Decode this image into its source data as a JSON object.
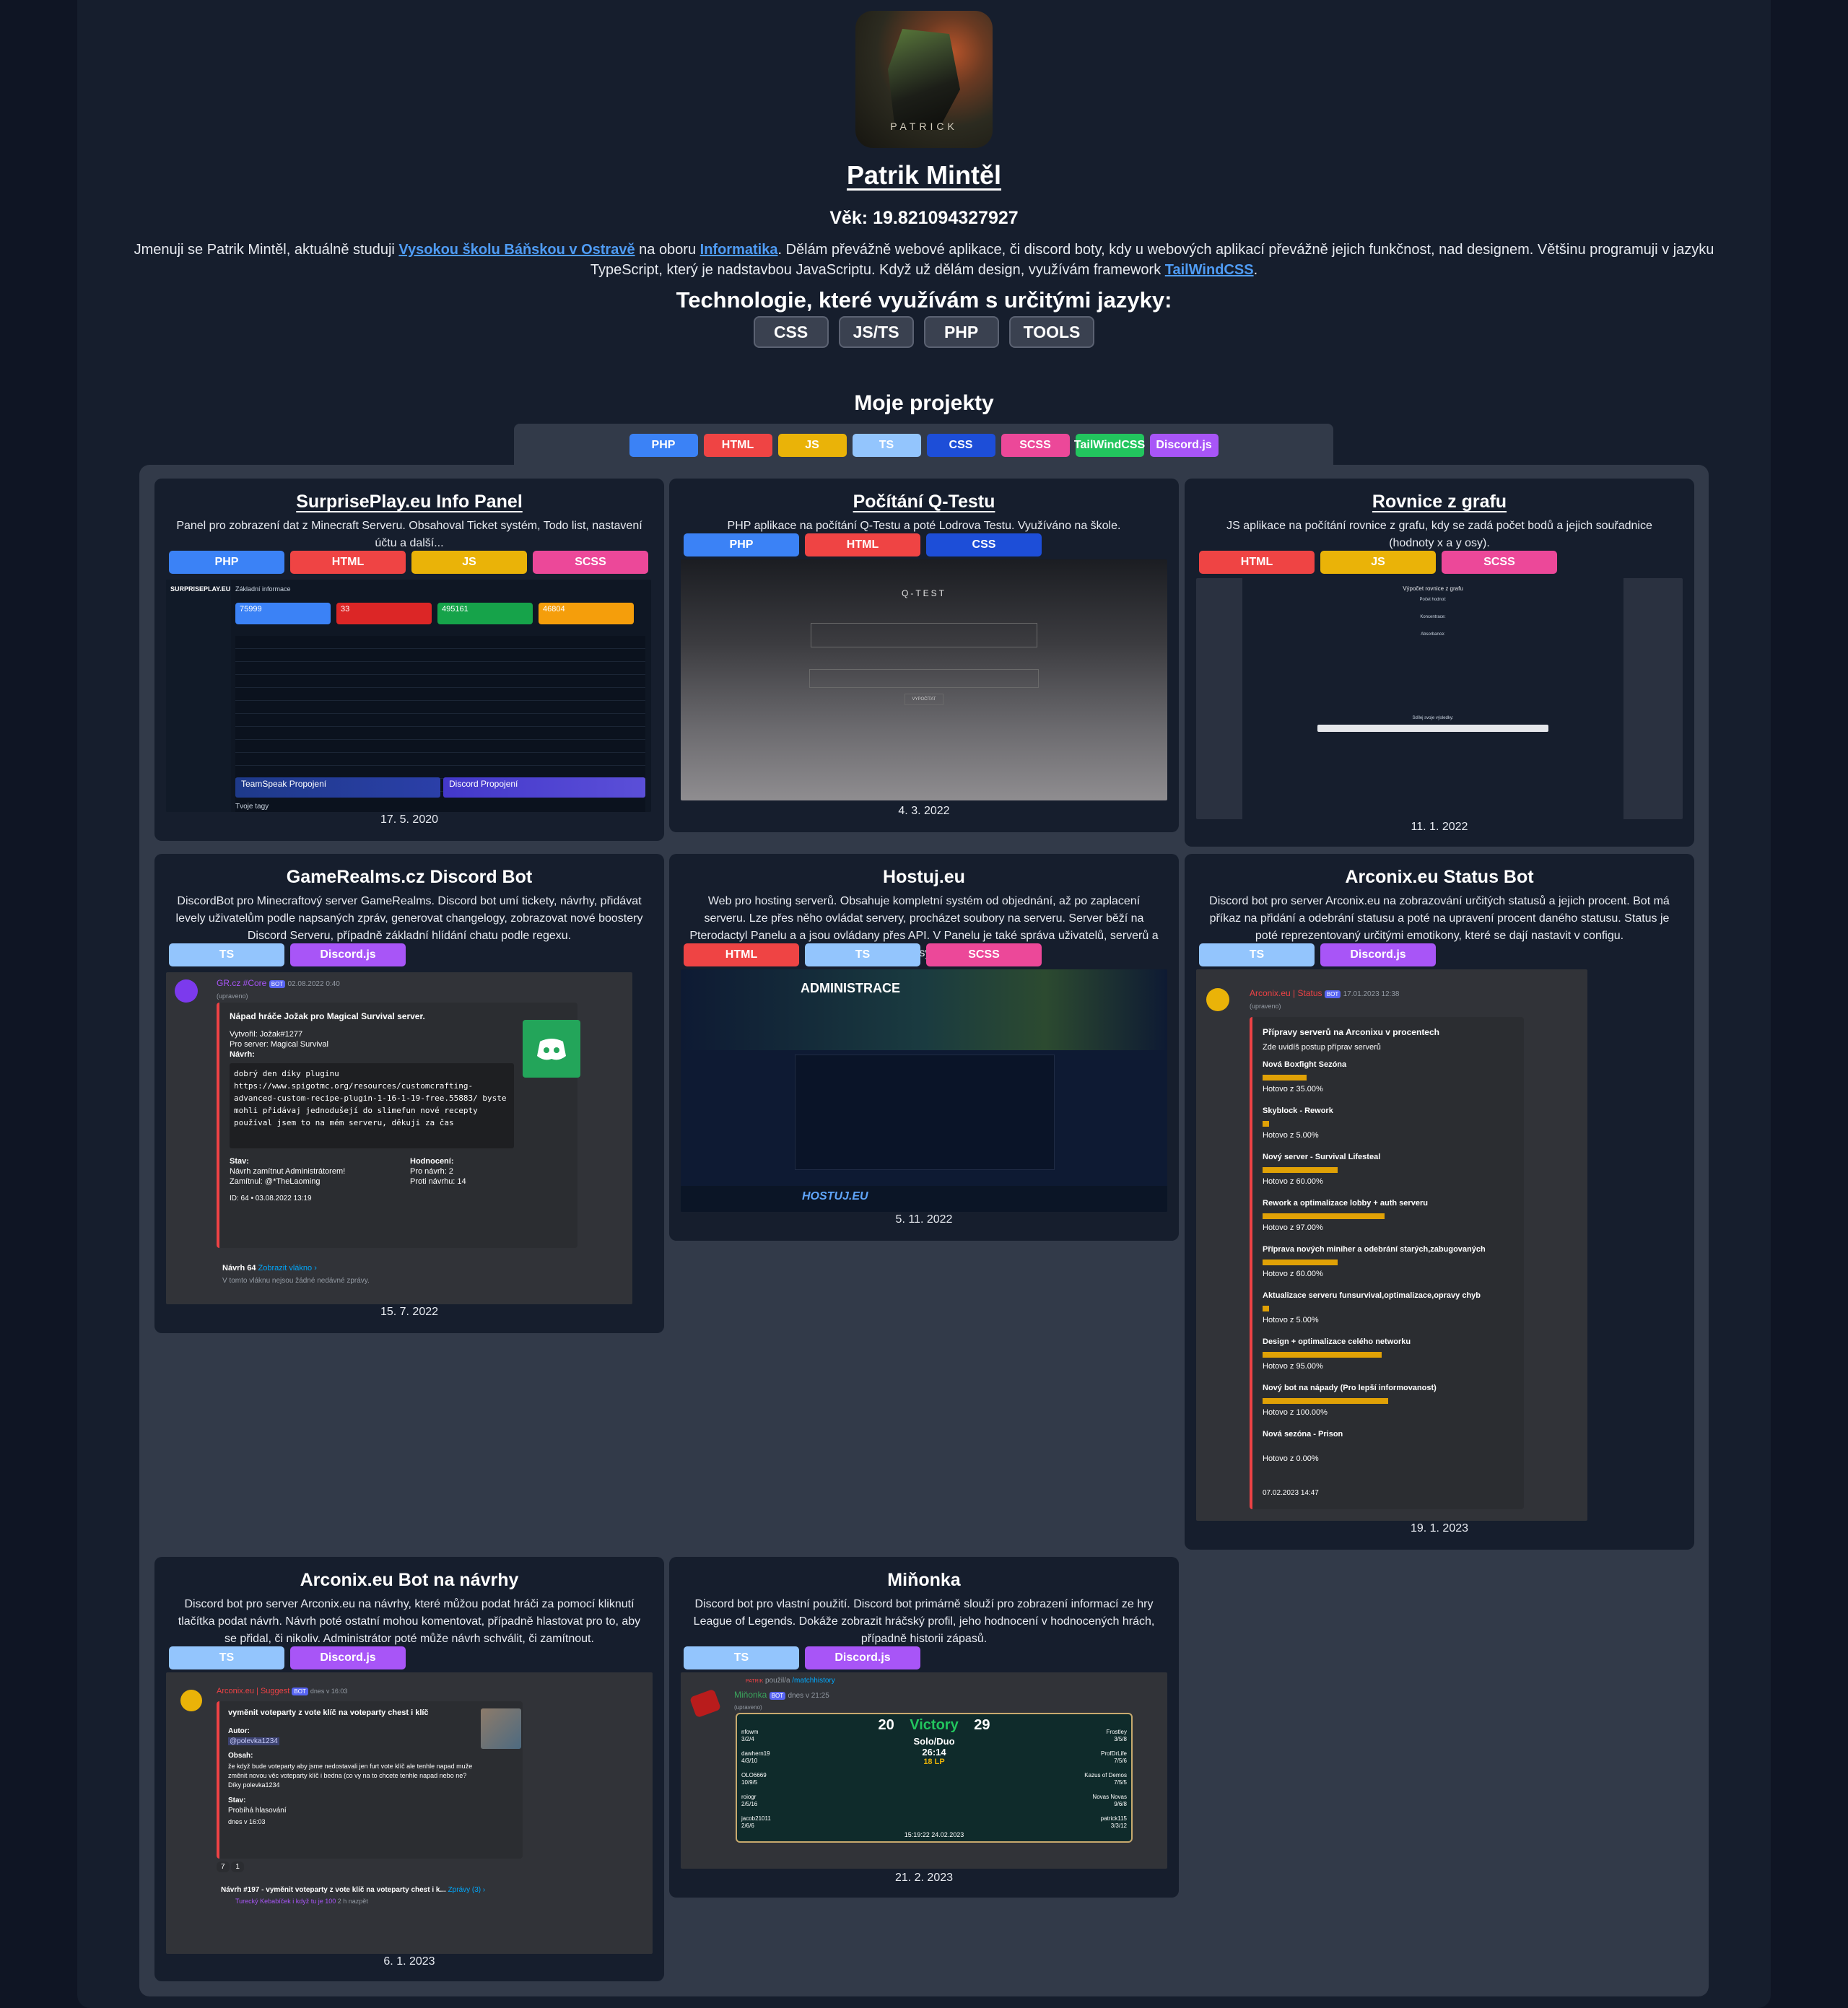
{
  "profile": {
    "avatar_caption": "PATRICK",
    "name": "Patrik Mintěl",
    "age": "Věk: 19.821094327927",
    "bio": {
      "p1": "Jmenuji se Patrik Mintěl, aktuálně studuji ",
      "link1": "Vysokou školu Báňskou v Ostravě",
      "p2": " na oboru ",
      "link2": "Informatika",
      "p3": ". Dělám převážně webové aplikace, či discord boty, kdy u webových aplikací převážně jejich funkčnost, nad designem. Většinu programuji v jazyku TypeScript, který je nadstavbou JavaScriptu. Když už dělám design, využívám framework ",
      "link3": "TailWindCSS",
      "p4": "."
    },
    "tech_title": "Technologie, které využívám s určitými jazyky:",
    "tech_buttons": [
      "CSS",
      "JS/TS",
      "PHP",
      "TOOLS"
    ]
  },
  "projects": {
    "title": "Moje projekty",
    "filters": [
      "PHP",
      "HTML",
      "JS",
      "TS",
      "CSS",
      "SCSS",
      "TailWindCSS",
      "Discord.js"
    ],
    "cards": [
      {
        "title": "SurprisePlay.eu Info Panel",
        "desc": "Panel pro zobrazení dat z Minecraft Serveru. Obsahoval Ticket systém, Todo list, nastavení účtu a další...",
        "tags": [
          "PHP",
          "HTML",
          "JS",
          "SCSS"
        ],
        "date": "17. 5. 2020",
        "shot": {
          "brand": "SURPRISEPLAY.EU",
          "section": "Základní informace",
          "stats": [
            "75999",
            "33",
            "495161",
            "46804"
          ],
          "teamspeak": "TeamSpeak Propojení",
          "discord": "Discord Propojení",
          "footer": "Tvoje tagy"
        }
      },
      {
        "title": "Počítání Q-Testu",
        "desc": "PHP aplikace na počítání Q-Testu a poté Lodrova Testu. Využíváno na škole.",
        "tags": [
          "PHP",
          "HTML",
          "CSS"
        ],
        "date": "4. 3. 2022",
        "shot": {
          "heading": "Q-TEST",
          "button": "VYPOČÍTAT"
        }
      },
      {
        "title": "Rovnice z grafu",
        "desc": "JS aplikace na počítání rovnice z grafu, kdy se zadá počet bodů a jejich souřadnice (hodnoty x a y osy).",
        "tags": [
          "HTML",
          "JS",
          "SCSS"
        ],
        "date": "11. 1. 2022",
        "shot": {
          "heading": "Výpočet rovnice z grafu",
          "sub1": "Počet hodnot:",
          "sub2": "Koncentrace:",
          "sub3": "Absorbance:",
          "share": "Sdílej svoje výsledky:"
        }
      },
      {
        "title": "GameRealms.cz Discord Bot",
        "desc": "DiscordBot pro Minecraftový server GameRealms. Discord bot umí tickety, návrhy, přidávat levely uživatelům podle napsaných zpráv, generovat changelogy, zobrazovat nové boostery Discord Serveru, případně základní hlídání chatu podle regexu.",
        "tags": [
          "TS",
          "Discord.js"
        ],
        "date": "15. 7. 2022",
        "shot": {
          "author": "GR.cz #Core",
          "badge": "BOT",
          "time": "02.08.2022 0:40",
          "edited": "(upraveno)",
          "embed_title": "Nápad hráče Jožak pro Magical Survival server.",
          "created": "Vytvořil: Jožak#1277",
          "server": "Pro server: Magical Survival",
          "proposal": "Návrh:",
          "code": "dobrý den díky pluginu https://www.spigotmc.org/resources/customcrafting-advanced-custom-recipe-plugin-1-16-1-19-free.55883/ byste mohli přidávaj jednodušejí do slimefun nové recepty používal jsem to na mém serveru, děkuji za čas",
          "status_label": "Stav:",
          "status": "Návrh zamítnut Administrátorem!",
          "rejected": "Zamítnul: @*TheLaoming",
          "rating_label": "Hodnocení:",
          "for": "Pro návrh: 2",
          "against": "Proti návrhu: 14",
          "id": "ID: 64 • 03.08.2022 13:19",
          "thread": "Návrh 64",
          "thread_link": "Zobrazit vlákno ›",
          "thread_empty": "V tomto vláknu nejsou žádné nedávné zprávy."
        }
      },
      {
        "title": "Hostuj.eu",
        "desc": "Web pro hosting serverů. Obsahuje kompletní systém od objednání, až po zaplacení serveru. Lze přes něho ovládat servery, procházet soubory na serveru. Server běží na Pterodactyl Panelu a a jsou ovládany přes API. V Panelu je také správa uživatelů, serverů a ticket systém.",
        "tags": [
          "HTML",
          "TS",
          "SCSS"
        ],
        "date": "5. 11. 2022",
        "shot": {
          "heading": "ADMINISTRACE",
          "logo": "HOSTUJ.EU"
        }
      },
      {
        "title": "Arconix.eu Status Bot",
        "desc": "Discord bot pro server Arconix.eu na zobrazování určitých statusů a jejich procent. Bot má příkaz na přidání a odebrání statusu a poté na upravení procent daného statusu. Status je poté reprezentovaný určitými emotikony, které se dají nastavit v configu.",
        "tags": [
          "TS",
          "Discord.js"
        ],
        "date": "19. 1. 2023",
        "shot": {
          "author": "Arconix.eu | Status",
          "badge": "BOT",
          "time": "17.01.2023 12:38",
          "edited": "(upraveno)",
          "embed_title": "Přípravy serverů na Arconixu v procentech",
          "embed_sub": "Zde uvidíš postup příprav serverů",
          "items": [
            {
              "name": "Nová Boxfight Sezóna",
              "progress": "Hotovo z 35.00%",
              "pct": 35
            },
            {
              "name": "Skyblock - Rework",
              "progress": "Hotovo z 5.00%",
              "pct": 5
            },
            {
              "name": "Nový server - Survival Lifesteal",
              "progress": "Hotovo z 60.00%",
              "pct": 60
            },
            {
              "name": "Rework a optimalizace lobby + auth serveru",
              "progress": "Hotovo z 97.00%",
              "pct": 97
            },
            {
              "name": "Příprava nových miniher a odebrání starých,zabugovaných",
              "progress": "Hotovo z 60.00%",
              "pct": 60
            },
            {
              "name": "Aktualizace serveru funsurvival,optimalizace,opravy chyb",
              "progress": "Hotovo z 5.00%",
              "pct": 5
            },
            {
              "name": "Design + optimalizace celého networku",
              "progress": "Hotovo z 95.00%",
              "pct": 95
            },
            {
              "name": "Nový bot na nápady (Pro lepší informovanost)",
              "progress": "Hotovo z 100.00%",
              "pct": 100
            },
            {
              "name": "Nová sezóna - Prison",
              "progress": "Hotovo z 0.00%",
              "pct": 0
            }
          ],
          "footer": "07.02.2023 14:47"
        }
      },
      {
        "title": "Arconix.eu Bot na návrhy",
        "desc": "Discord bot pro server Arconix.eu na návrhy, které můžou podat hráči za pomocí kliknutí tlačítka podat návrh. Návrh poté ostatní mohou komentovat, případně hlastovat pro to, aby se přidal, či nikoliv. Administrátor poté může návrh schválit, či zamítnout.",
        "tags": [
          "TS",
          "Discord.js"
        ],
        "date": "6. 1. 2023",
        "shot": {
          "author": "Arconix.eu | Suggest",
          "badge": "BOT",
          "time": "dnes v 16:03",
          "embed_title": "vyměnit voteparty z vote klíč  na voteparty chest i klíč",
          "author_label": "Autor:",
          "author_value": "@polevka1234",
          "content_label": "Obsah:",
          "content": "že když bude voteparty aby jsme nedostavali jen furt vote klíč ale tenhle napad muže změnit novou věc voteparty klíč i bedna (co vy na to chcete tenhle napad nebo ne? Díky polevka1234",
          "status_label": "Stav:",
          "status": "Probíhá hlasování",
          "status_time": "dnes v 16:03",
          "up": "7",
          "down": "1",
          "thread": "Návrh #197 - vyměnit voteparty z vote klíč na voteparty chest i k...",
          "thread_link": "Zprávy (3) ›",
          "thread_reply": "Turecký Kebabíček  i když tu je 100",
          "thread_time": "2 h nazpět"
        }
      },
      {
        "title": "Miňonka",
        "desc": "Discord bot pro vlastní použití. Discord bot primárně slouží pro zobrazení informací ze hry League of Legends. Dokáže zobrazit hráčský profil, jeho hodnocení v hodnocených hrách, případně historii zápasů.",
        "tags": [
          "TS",
          "Discord.js"
        ],
        "date": "21. 2. 2023",
        "shot": {
          "used": "použil/a",
          "command": "/matchhistory",
          "user": "PATRIK",
          "author": "Miňonka",
          "badge": "BOT",
          "time": "dnes v 21:25",
          "edited": "(upraveno)",
          "score_left": "20",
          "result": "Victory",
          "score_right": "29",
          "mode": "Solo/Duo",
          "duration": "26:14",
          "lp": "18 LP",
          "timestamp": "15:19:22 24.02.2023",
          "left_players": [
            [
              "nfowm",
              "3/2/4"
            ],
            [
              "dawhern19",
              "4/3/10"
            ],
            [
              "OLO6669",
              "10/9/5"
            ],
            [
              "roiogr",
              "2/5/16"
            ],
            [
              "jacob21011",
              "2/6/6"
            ]
          ],
          "right_players": [
            [
              "Frostley",
              "3/5/8"
            ],
            [
              "ProfDrLife",
              "7/5/6"
            ],
            [
              "Kazus of Demos",
              "7/5/5"
            ],
            [
              "Novas Novas",
              "9/6/8"
            ],
            [
              "patrick115",
              "3/3/12"
            ]
          ]
        }
      }
    ]
  }
}
